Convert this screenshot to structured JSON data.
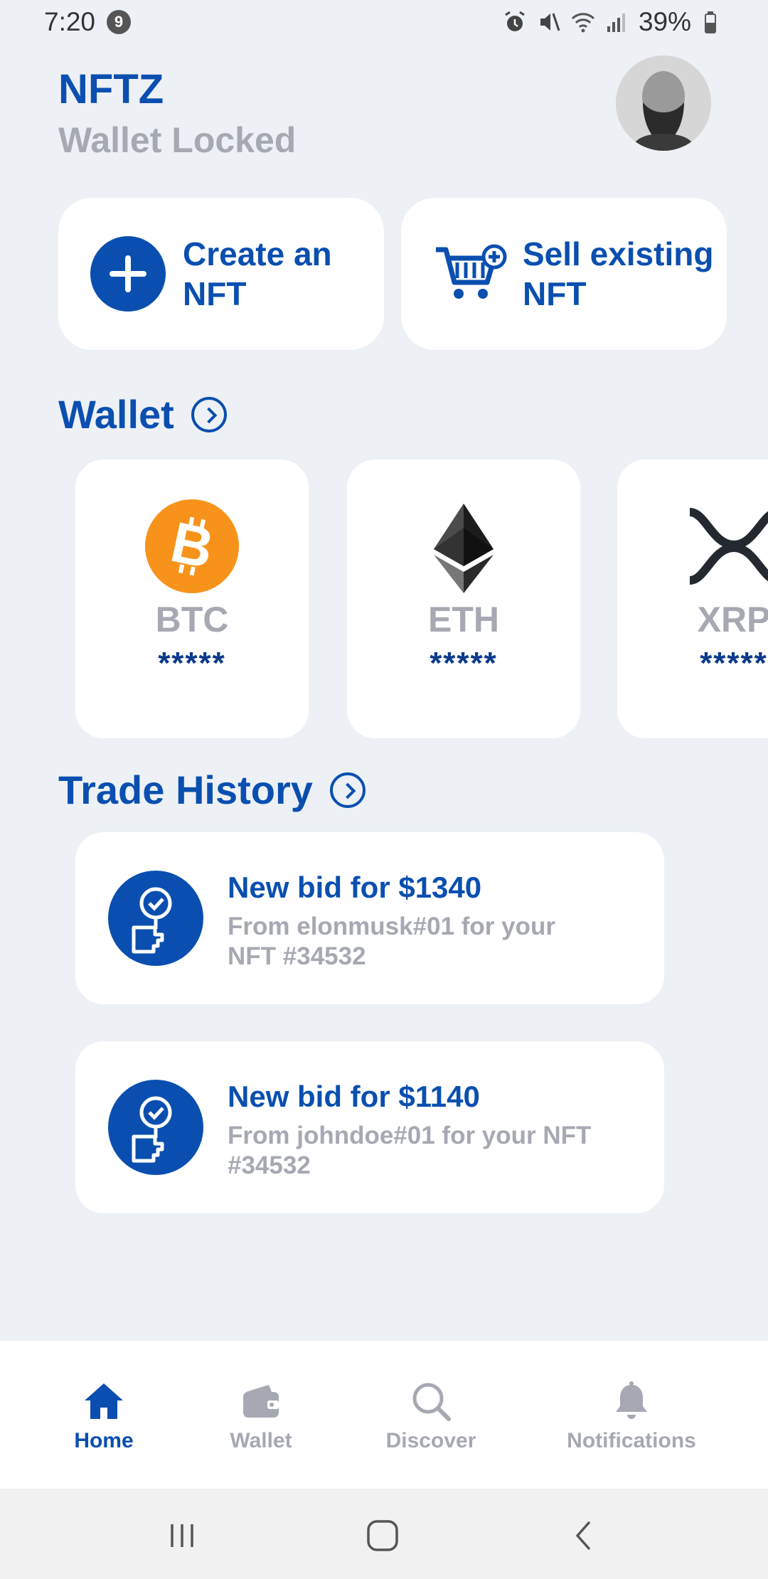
{
  "status_bar": {
    "time": "7:20",
    "notification_count": "9",
    "battery": "39%"
  },
  "header": {
    "title": "NFTZ",
    "subtitle": "Wallet Locked"
  },
  "actions": {
    "create_label": "Create an NFT",
    "sell_label": "Sell existing NFT"
  },
  "wallet": {
    "title": "Wallet",
    "coins": [
      {
        "symbol": "BTC",
        "balance": "*****",
        "icon": "bitcoin-icon"
      },
      {
        "symbol": "ETH",
        "balance": "*****",
        "icon": "ethereum-icon"
      },
      {
        "symbol": "XRP",
        "balance": "*****",
        "icon": "xrp-icon"
      }
    ]
  },
  "trade_history": {
    "title": "Trade History",
    "items": [
      {
        "title": "New bid for $1340",
        "desc": "From elonmusk#01 for your NFT #34532"
      },
      {
        "title": "New bid for $1140",
        "desc": "From johndoe#01 for your NFT #34532"
      }
    ]
  },
  "nav": {
    "home": "Home",
    "wallet": "Wallet",
    "discover": "Discover",
    "notifications": "Notifications"
  },
  "colors": {
    "accent": "#0a4fb0",
    "muted": "#a6a9b2",
    "background": "#edf1f5",
    "bitcoin": "#f7931a"
  }
}
